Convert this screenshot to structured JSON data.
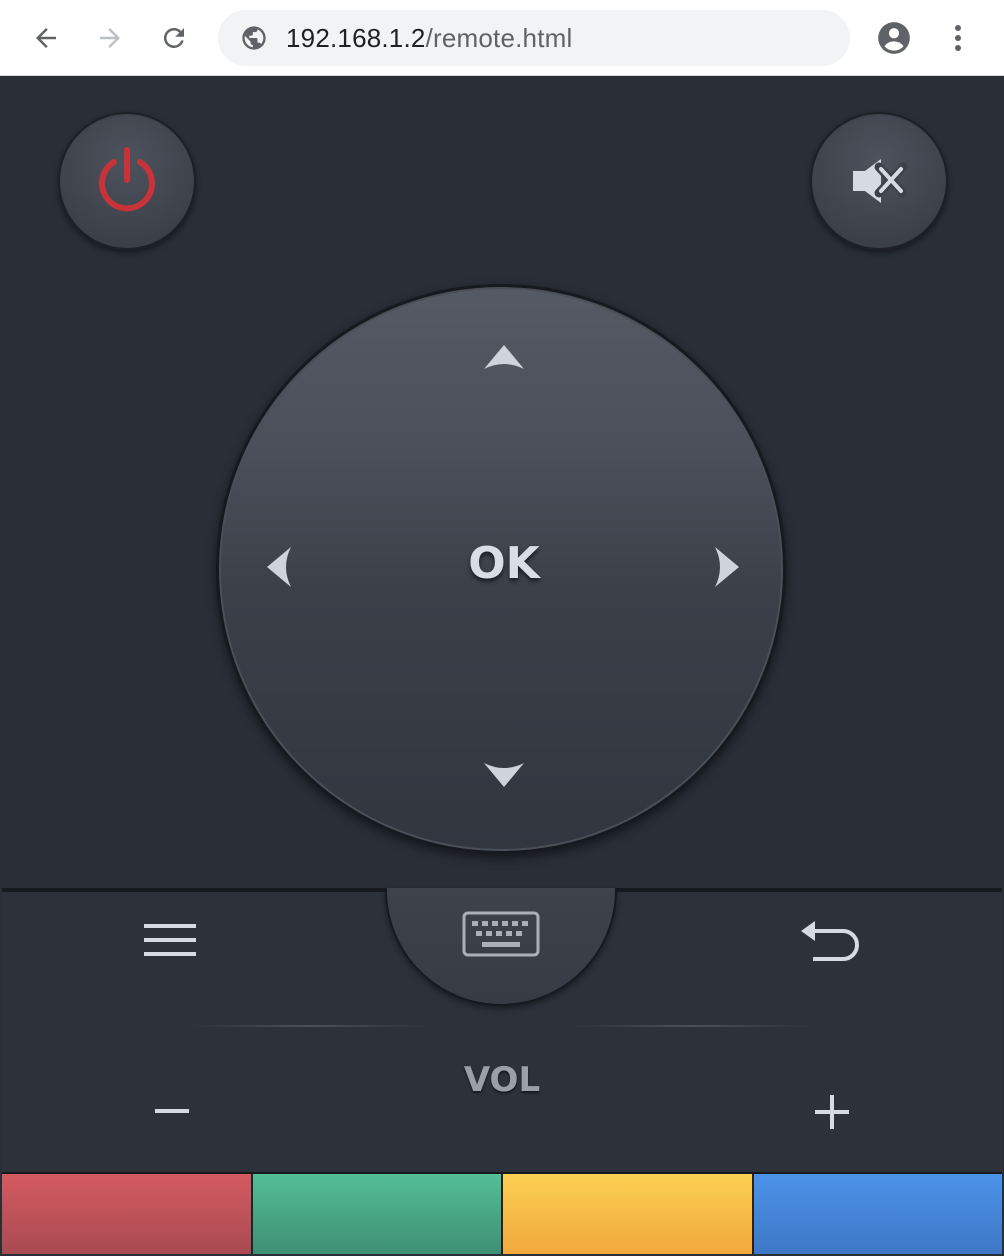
{
  "browser": {
    "url_host": "192.168.1.2",
    "url_path": "/remote.html",
    "icons": {
      "back": "back-arrow-icon",
      "forward": "forward-arrow-icon",
      "reload": "reload-icon",
      "site_info": "globe-icon",
      "profile": "account-circle-icon",
      "menu": "more-vert-icon"
    }
  },
  "remote": {
    "power_icon": "power-icon",
    "mute_icon": "mute-icon",
    "dpad": {
      "ok_label": "OK",
      "up_icon": "arrow-up-icon",
      "down_icon": "arrow-down-icon",
      "left_icon": "arrow-left-icon",
      "right_icon": "arrow-right-icon"
    },
    "menu_icon": "menu-icon",
    "keyboard_icon": "keyboard-icon",
    "back_icon": "return-icon",
    "volume": {
      "label": "VOL",
      "minus": "−",
      "plus": "+"
    },
    "color_buttons": [
      {
        "name": "red",
        "top": "#d45a60",
        "bottom": "#a94a52"
      },
      {
        "name": "green",
        "top": "#53bf96",
        "bottom": "#3e8f74"
      },
      {
        "name": "yellow",
        "top": "#fbd052",
        "bottom": "#f0a83c"
      },
      {
        "name": "blue",
        "top": "#4b93e8",
        "bottom": "#3f77c6"
      }
    ],
    "colors": {
      "background": "#292e37",
      "power_red": "#c8333a",
      "icon_light": "#d6dae2"
    }
  }
}
